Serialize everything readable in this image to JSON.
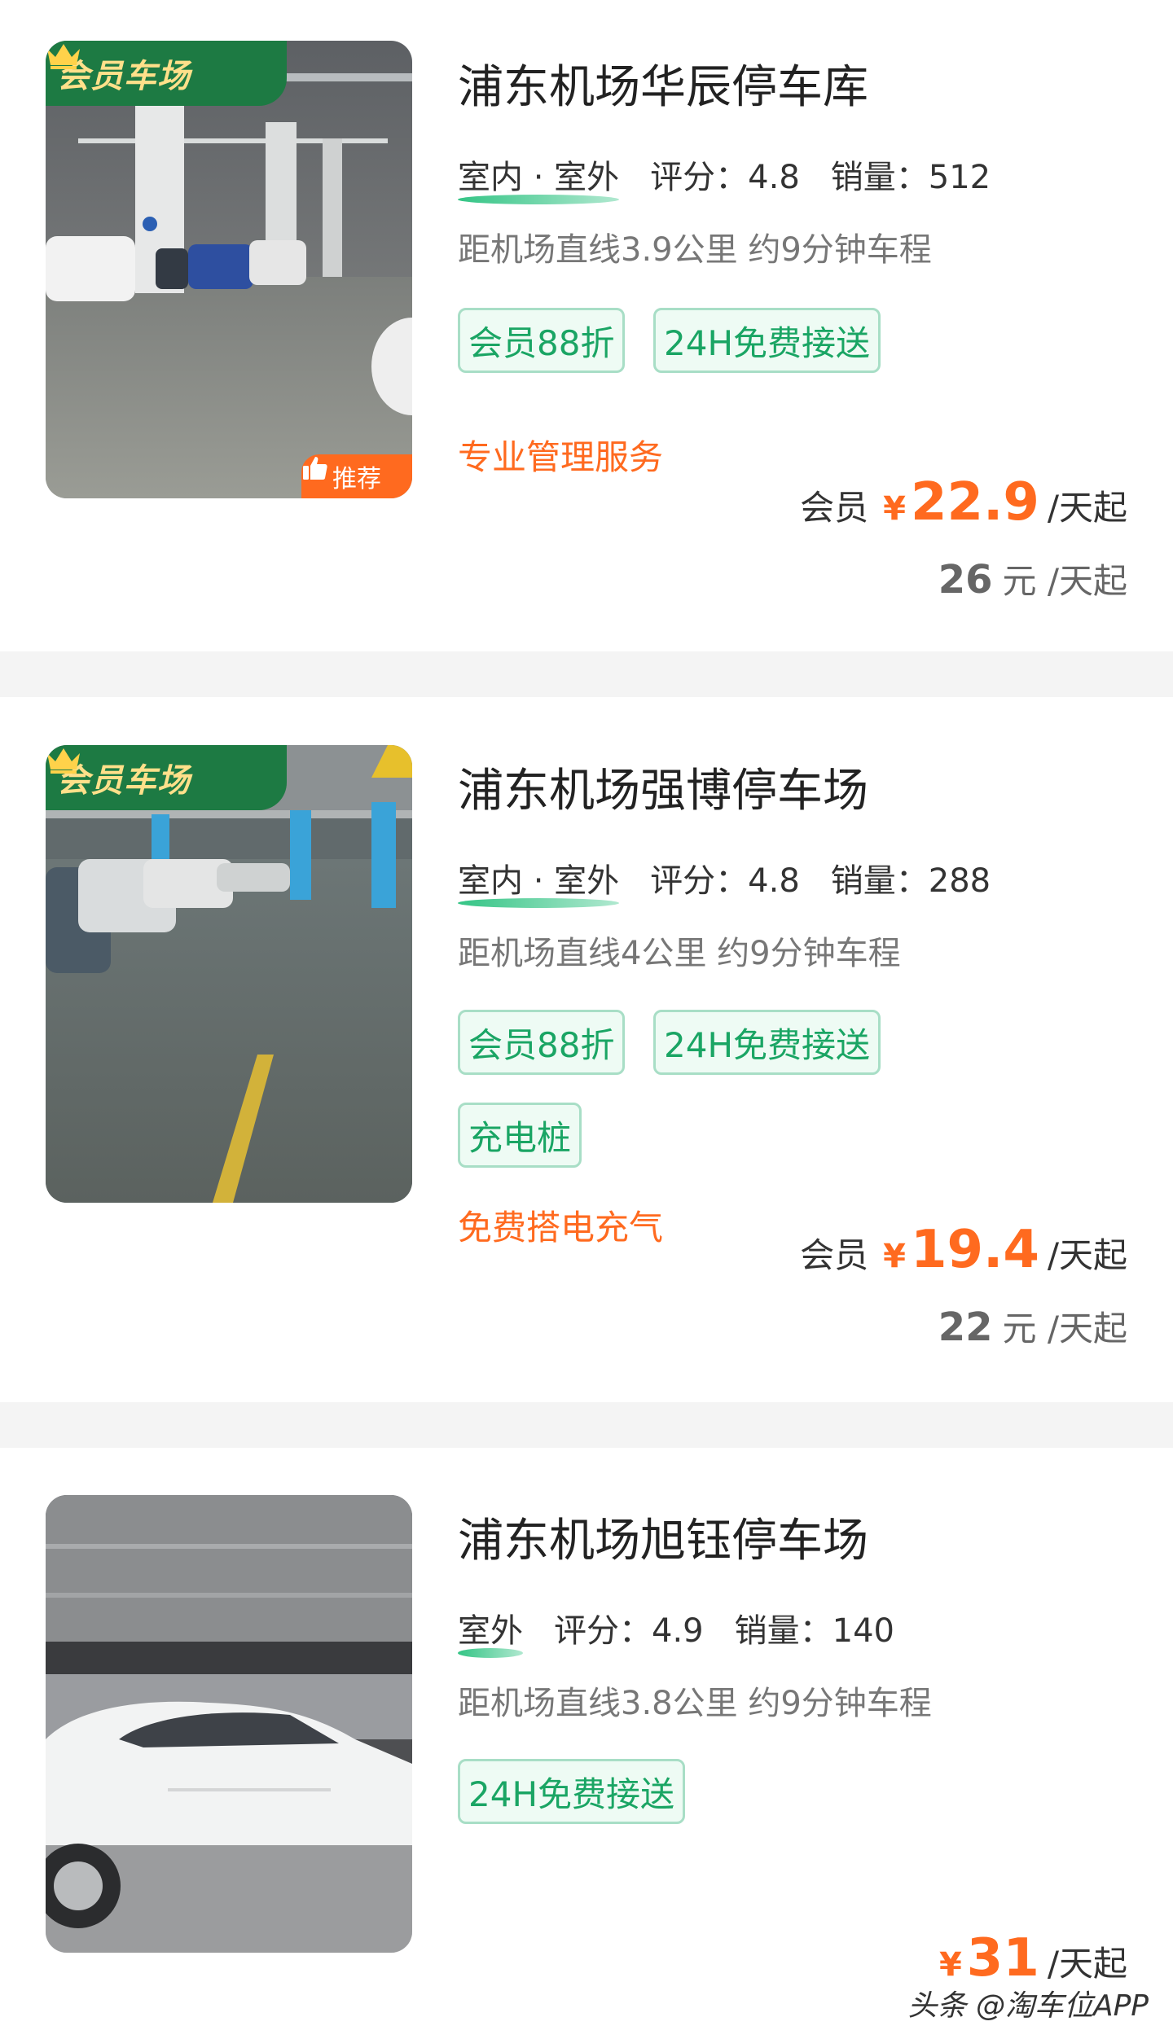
{
  "listings": [
    {
      "vip_badge": "会员车场",
      "recommend_badge": "推荐",
      "title": "浦东机场华辰停车库",
      "type": "室内 · 室外",
      "rating": "评分：4.8",
      "sales": "销量：512",
      "distance": "距机场直线3.9公里 约9分钟车程",
      "tags": [
        "会员88折",
        "24H免费接送"
      ],
      "promo": "专业管理服务",
      "price_label": "会员",
      "currency": "¥",
      "price": "22.9",
      "price_unit": "/天起",
      "original_price": "26",
      "original_unit": "元 /天起"
    },
    {
      "vip_badge": "会员车场",
      "title": "浦东机场强博停车场",
      "type": "室内 · 室外",
      "rating": "评分：4.8",
      "sales": "销量：288",
      "distance": "距机场直线4公里 约9分钟车程",
      "tags": [
        "会员88折",
        "24H免费接送",
        "充电桩"
      ],
      "promo": "免费搭电充气",
      "price_label": "会员",
      "currency": "¥",
      "price": "19.4",
      "price_unit": "/天起",
      "original_price": "22",
      "original_unit": "元 /天起"
    },
    {
      "title": "浦东机场旭钰停车场",
      "type": "室外",
      "rating": "评分：4.9",
      "sales": "销量：140",
      "distance": "距机场直线3.8公里 约9分钟车程",
      "tags": [
        "24H免费接送"
      ],
      "currency": "¥",
      "price": "31",
      "price_unit": "/天起"
    }
  ],
  "watermark": "头条 @淘车位APP",
  "colors": {
    "accent_orange": "#ff6a1f",
    "tag_green": "#1aa564",
    "vip_green": "#1d7a43",
    "vip_gold": "#ffe08a"
  },
  "icons": [
    "crown-icon",
    "thumbs-up-icon"
  ]
}
